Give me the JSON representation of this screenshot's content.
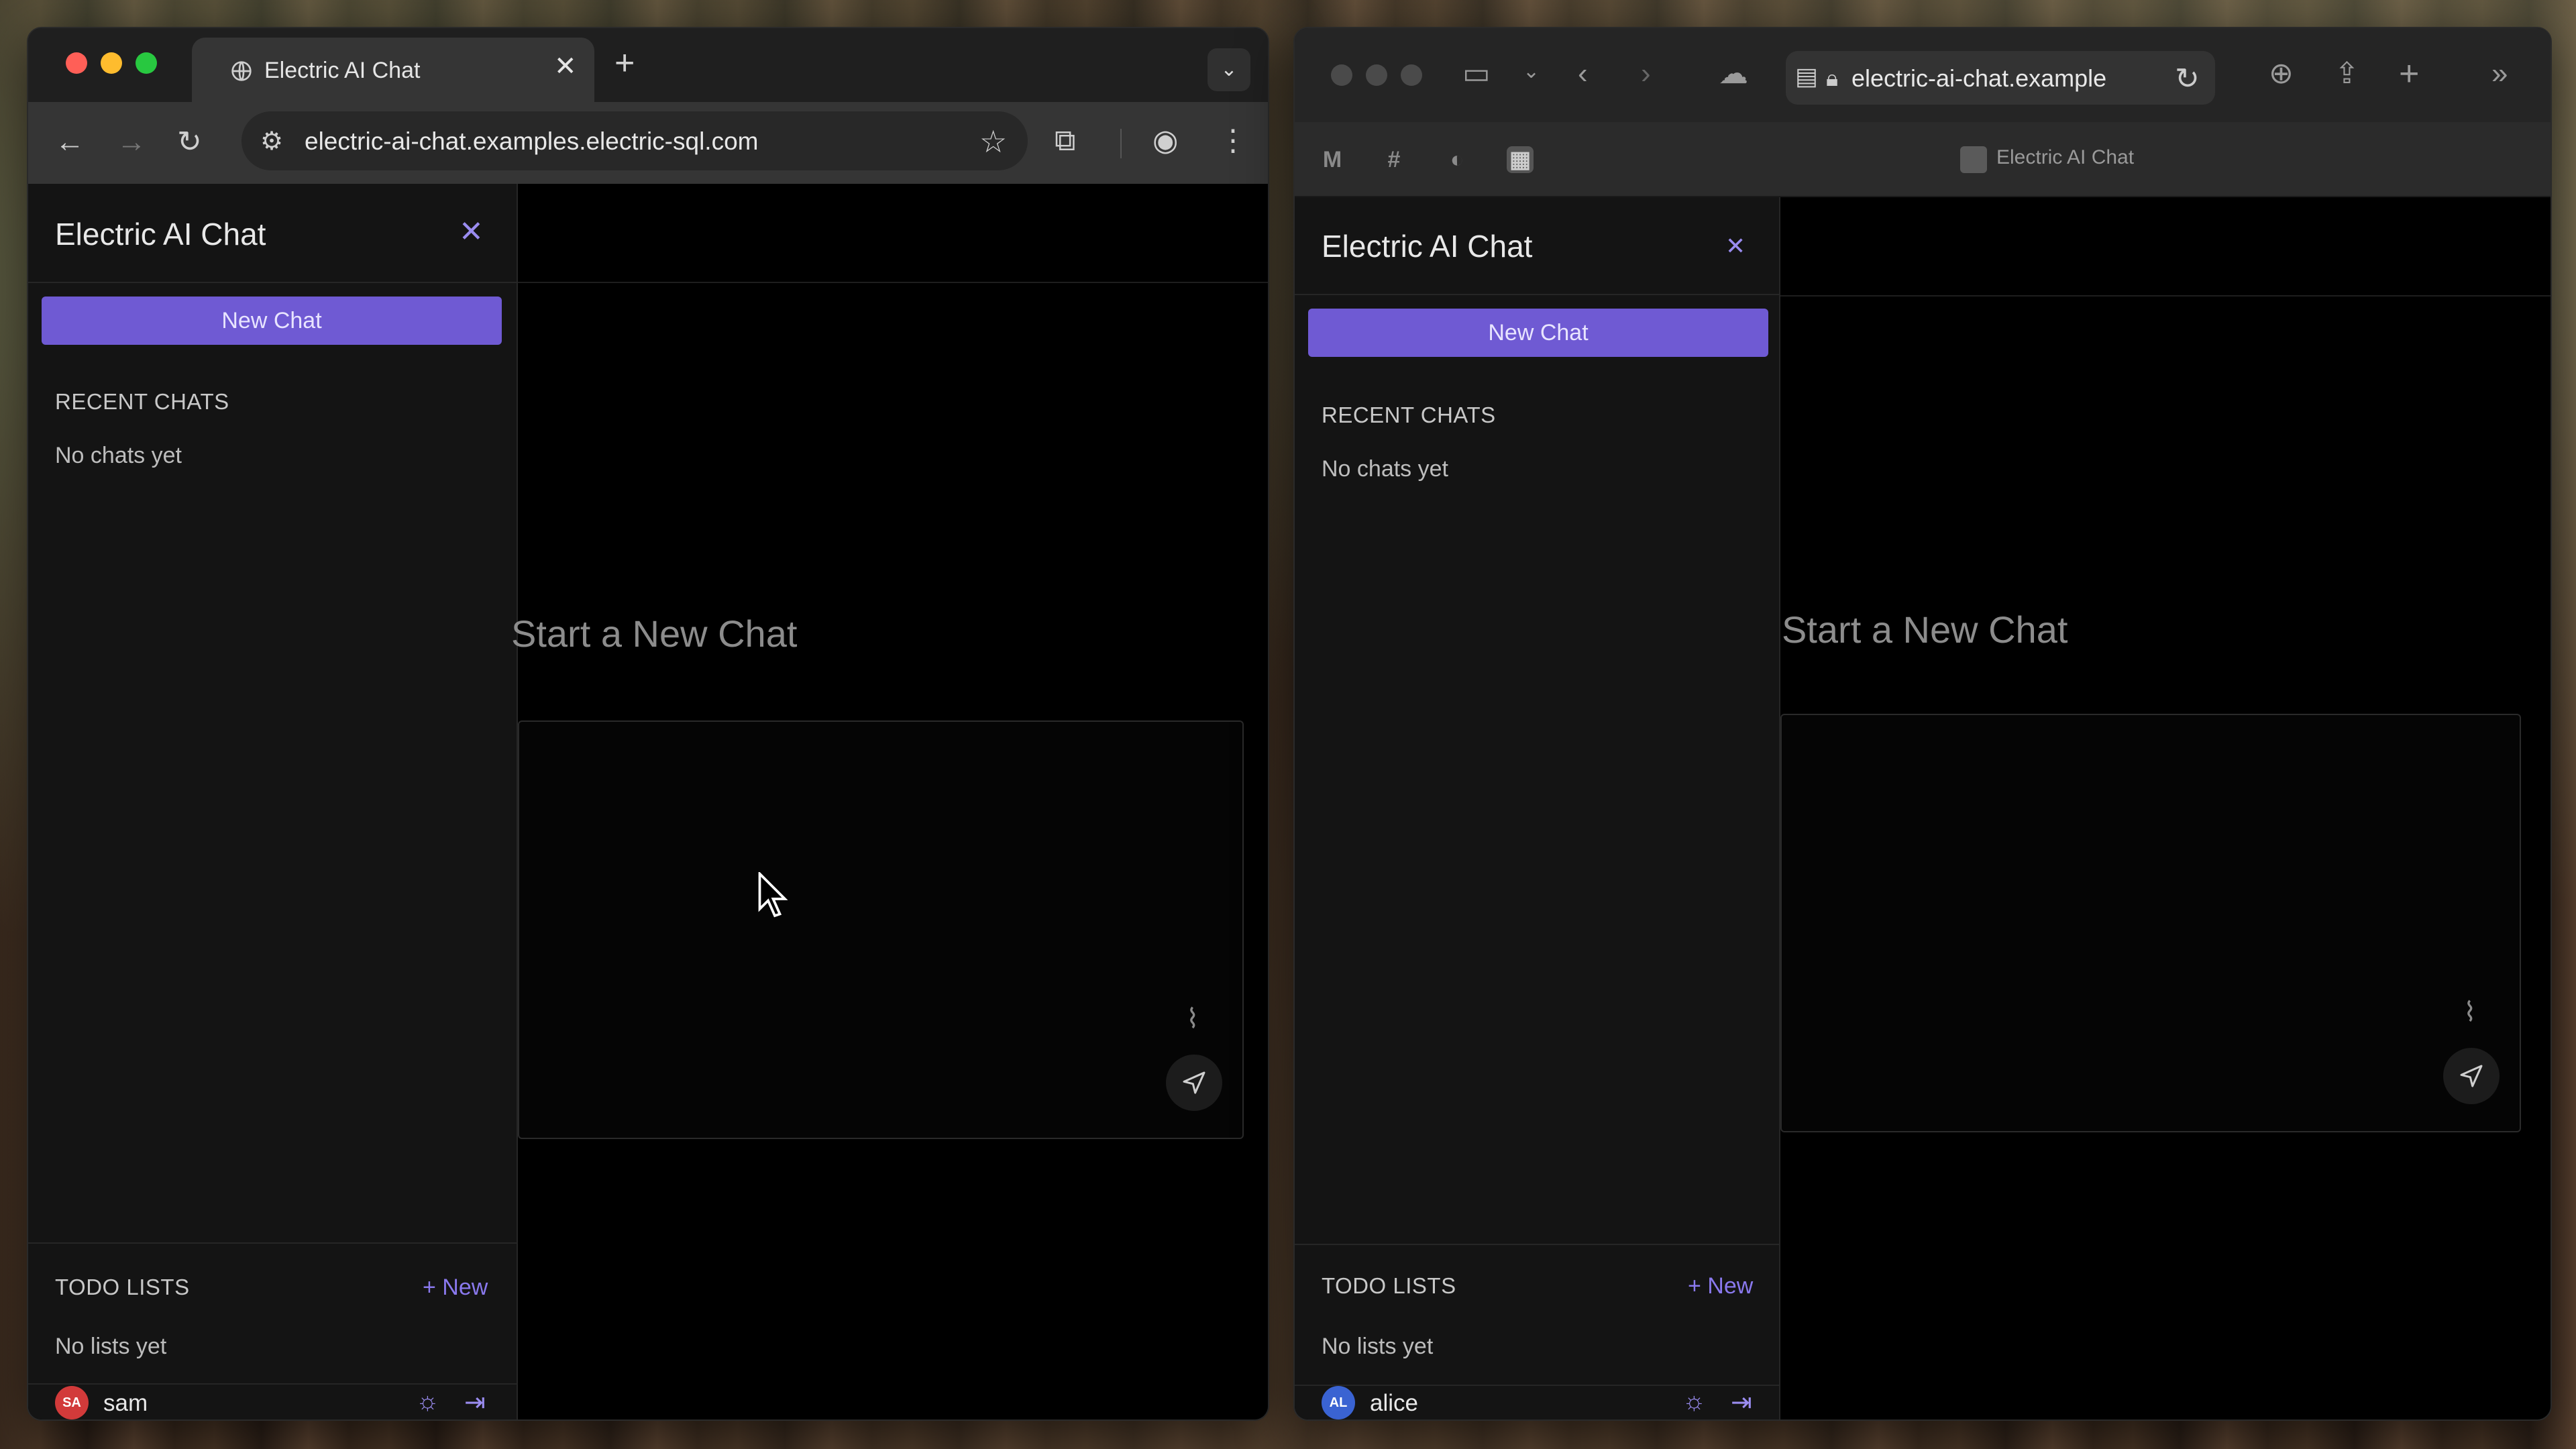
{
  "left_window": {
    "tab_title": "Electric AI Chat",
    "url": "electric-ai-chat.examples.electric-sql.com",
    "sidebar": {
      "title": "Electric AI Chat",
      "new_chat_label": "New Chat",
      "recent_label": "RECENT CHATS",
      "recent_empty": "No chats yet",
      "todo_label": "TODO LISTS",
      "todo_new_label": "+ New",
      "todo_empty": "No lists yet",
      "user": {
        "initials": "SA",
        "name": "sam",
        "avatar_color": "#d23a3a"
      }
    },
    "main": {
      "heading": "Start a New Chat"
    }
  },
  "right_window": {
    "url": "electric-ai-chat.example",
    "tab_title": "Electric AI Chat",
    "sidebar": {
      "title": "Electric AI Chat",
      "new_chat_label": "New Chat",
      "recent_label": "RECENT CHATS",
      "recent_empty": "No chats yet",
      "todo_label": "TODO LISTS",
      "todo_new_label": "+ New",
      "todo_empty": "No lists yet",
      "user": {
        "initials": "AL",
        "name": "alice",
        "avatar_color": "#3a63d2"
      }
    },
    "main": {
      "heading": "Start a New Chat"
    }
  },
  "colors": {
    "accent": "#6f5ad3",
    "accent_text": "#8a79ee",
    "background": "#000000",
    "sidebar": "#141414"
  }
}
